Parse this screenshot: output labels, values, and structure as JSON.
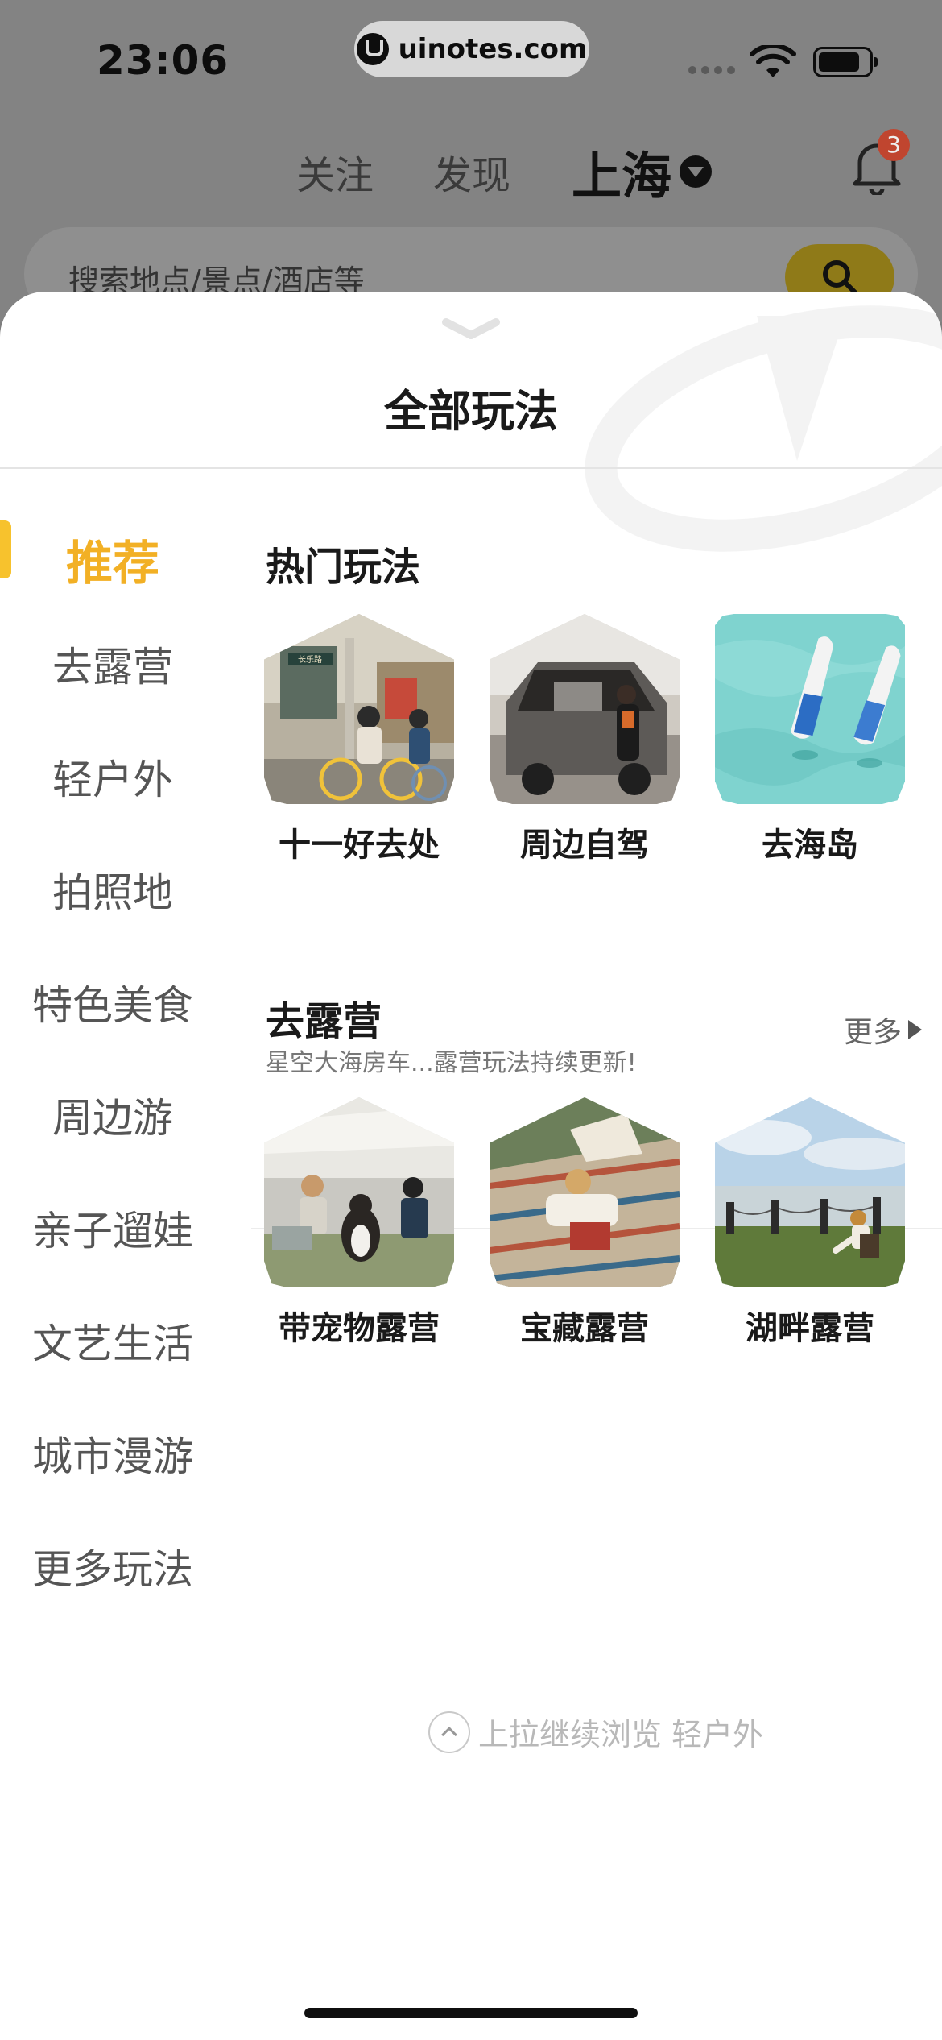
{
  "status_bar": {
    "time": "23:06",
    "url": "uinotes.com"
  },
  "top_nav": {
    "tabs": [
      "关注",
      "发现"
    ],
    "city": "上海",
    "notification_count": "3"
  },
  "search": {
    "placeholder": "搜索地点/景点/酒店等"
  },
  "sheet": {
    "title": "全部玩法",
    "categories": [
      {
        "label": "推荐",
        "active": true
      },
      {
        "label": "去露营",
        "active": false
      },
      {
        "label": "轻户外",
        "active": false
      },
      {
        "label": "拍照地",
        "active": false
      },
      {
        "label": "特色美食",
        "active": false
      },
      {
        "label": "周边游",
        "active": false
      },
      {
        "label": "亲子遛娃",
        "active": false
      },
      {
        "label": "文艺生活",
        "active": false
      },
      {
        "label": "城市漫游",
        "active": false
      },
      {
        "label": "更多玩法",
        "active": false
      }
    ],
    "hot": {
      "title": "热门玩法",
      "items": [
        {
          "label": "十一好去处",
          "image": "street-cyclists-photo",
          "shop_sign": "长乐路"
        },
        {
          "label": "周边自驾",
          "image": "car-trunk-roadtrip-photo"
        },
        {
          "label": "去海岛",
          "image": "boats-turquoise-sea-photo"
        }
      ]
    },
    "camping": {
      "title": "去露营",
      "subtitle": "星空大海房车...露营玩法持续更新!",
      "more_label": "更多",
      "items": [
        {
          "label": "带宠物露营",
          "image": "dog-camping-photo"
        },
        {
          "label": "宝藏露营",
          "image": "picnic-blanket-reading-photo"
        },
        {
          "label": "湖畔露营",
          "image": "lakeside-chair-photo"
        }
      ]
    },
    "pull_hint": "上拉继续浏览 轻户外"
  },
  "colors": {
    "accent": "#f2b025",
    "badge": "#e14a2d"
  }
}
